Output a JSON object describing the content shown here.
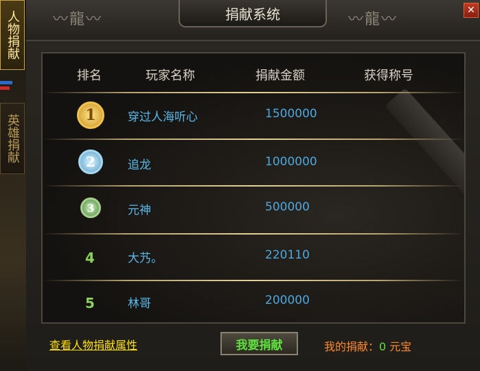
{
  "window": {
    "title": "捐献系统",
    "close_label": "✕"
  },
  "side_tabs": [
    {
      "label": "人物捐献",
      "active": true
    },
    {
      "label": "英雄捐献",
      "active": false
    }
  ],
  "table": {
    "headers": [
      "排名",
      "玩家名称",
      "捐献金额",
      "获得称号"
    ],
    "rows": [
      {
        "rank": "1",
        "medal": "gold-medal-icon",
        "name": "穿过人海听心",
        "amount": "1500000",
        "title": ""
      },
      {
        "rank": "2",
        "medal": "silver-medal-icon",
        "name": "追龙",
        "amount": "1000000",
        "title": ""
      },
      {
        "rank": "3",
        "medal": "bronze-medal-icon",
        "name": "元神",
        "amount": "500000",
        "title": ""
      },
      {
        "rank": "4",
        "medal": "",
        "name": "大艿。",
        "amount": "220110",
        "title": ""
      },
      {
        "rank": "5",
        "medal": "",
        "name": "林哥",
        "amount": "200000",
        "title": ""
      }
    ]
  },
  "footer": {
    "view_attributes_link": "查看人物捐献属性",
    "donate_button": "我要捐献",
    "my_donation_label": "我的捐献：",
    "my_donation_value": "0",
    "my_donation_unit": "元宝"
  },
  "colors": {
    "accent_gold": "#e5d39a",
    "name_blue": "#5ab8e8",
    "button_green": "#5ee23e",
    "link_yellow": "#ffe000",
    "label_orange": "#ff8a2a"
  }
}
